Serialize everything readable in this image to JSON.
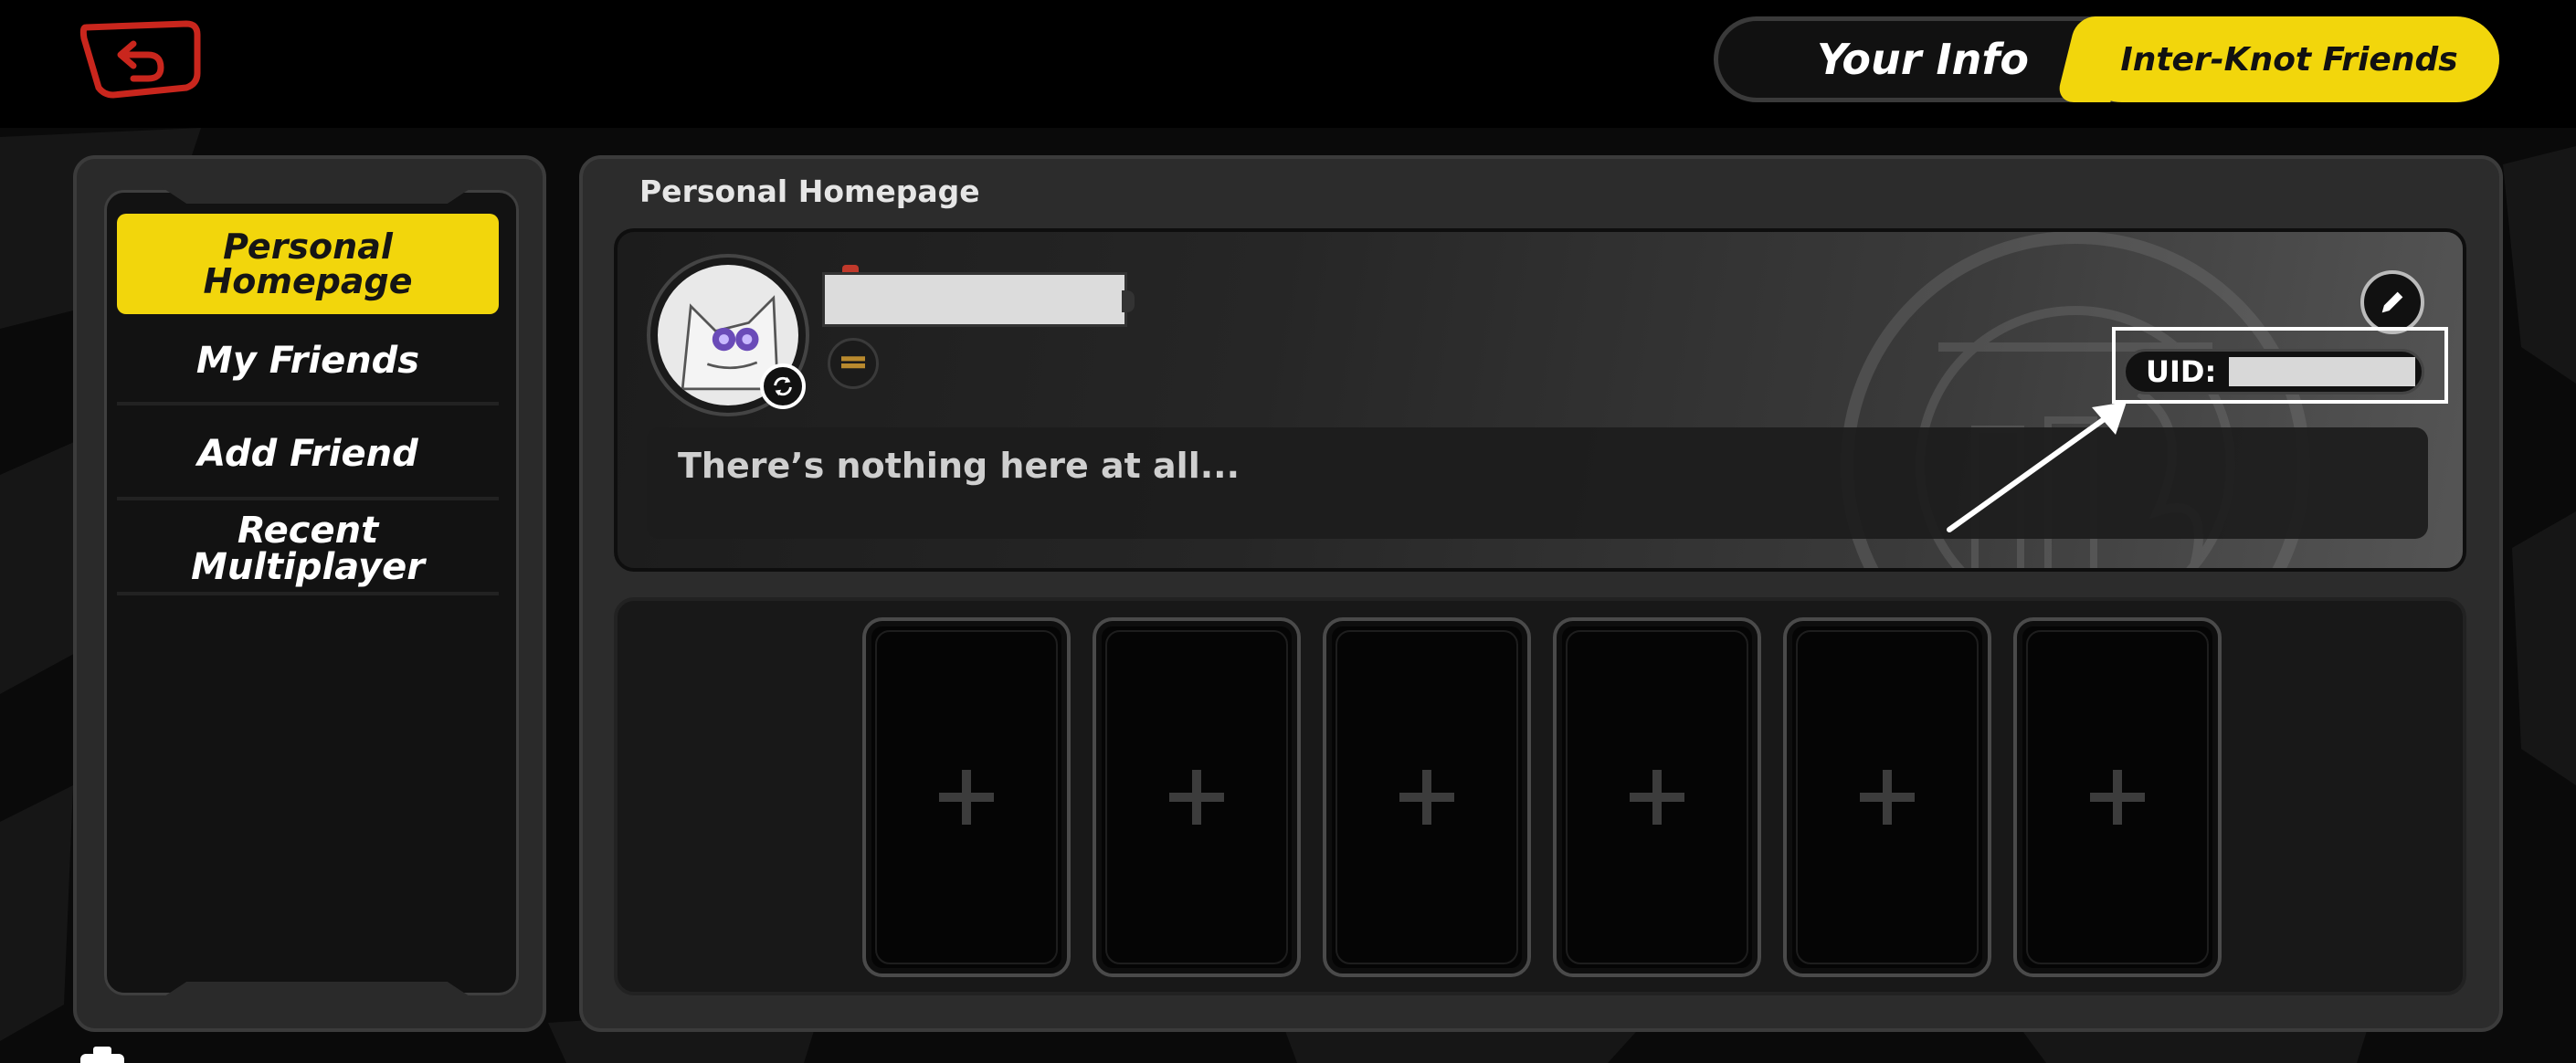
{
  "tabs": {
    "your_info": "Your Info",
    "inter_knot_friends": "Inter-Knot Friends",
    "active": "inter_knot_friends"
  },
  "sidebar": {
    "items": [
      {
        "label": "Personal Homepage",
        "active": true
      },
      {
        "label": "My Friends",
        "active": false
      },
      {
        "label": "Add Friend",
        "active": false
      },
      {
        "label": "Recent Multiplayer",
        "active": false
      }
    ]
  },
  "main": {
    "section_title": "Personal Homepage",
    "profile": {
      "uid_label": "UID:",
      "bio": "There’s nothing here at all..."
    },
    "showcase": {
      "slots": [
        "+",
        "+",
        "+",
        "+",
        "+",
        "+"
      ]
    }
  },
  "colors": {
    "accent_yellow": "#f2d60c",
    "back_red": "#c9261d",
    "panel": "#2c2c2c",
    "background": "#070707"
  },
  "icons": [
    "back-icon",
    "swap-icon",
    "level-icon",
    "edit-pencil-icon",
    "plus-icon"
  ]
}
